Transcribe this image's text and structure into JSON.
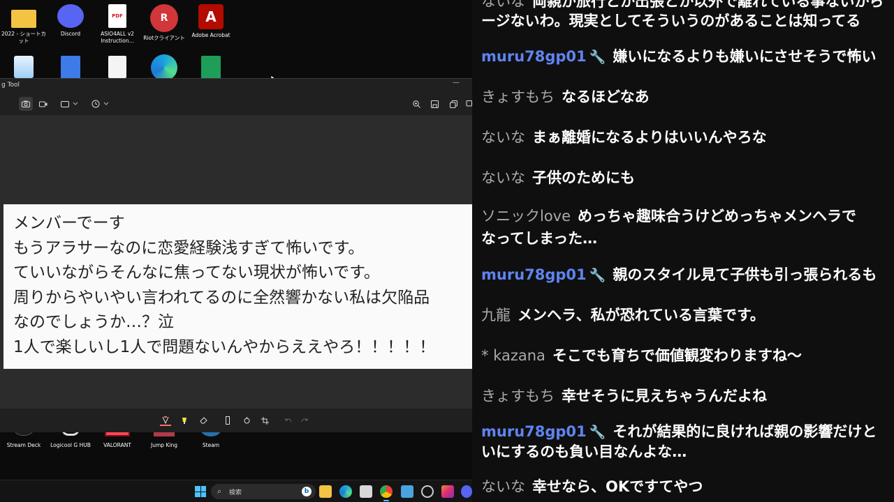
{
  "desktop": {
    "top_icons": [
      {
        "label": "2022 - ショートカット",
        "icon": "folder-icon"
      },
      {
        "label": "Discord",
        "icon": "discord-icon"
      },
      {
        "label": "ASIO4ALL v2 Instruction...",
        "icon": "pdf-icon",
        "badge": "PDF"
      },
      {
        "label": "Riotクライアント",
        "icon": "riot-icon",
        "badge": "R"
      },
      {
        "label": "Adobe Acrobat",
        "icon": "acrobat-icon",
        "badge": "A"
      }
    ],
    "second_row_icons": [
      {
        "icon": "recycle-bin-icon"
      },
      {
        "icon": "google-docs-icon"
      },
      {
        "icon": "file-icon"
      },
      {
        "icon": "edge-icon"
      },
      {
        "icon": "google-sheets-icon"
      }
    ],
    "bottom_icons": [
      {
        "label": "Stream Deck",
        "icon": "stream-deck-icon"
      },
      {
        "label": "Logicool G HUB",
        "icon": "ghub-icon"
      },
      {
        "label": "VALORANT",
        "icon": "valorant-icon"
      },
      {
        "label": "Jump King",
        "icon": "jump-king-icon"
      },
      {
        "label": "Steam",
        "icon": "steam-icon"
      }
    ]
  },
  "snipping_tool": {
    "title": "g Tool",
    "minimize": "—",
    "snip_text_lines": [
      "メンバーでーす",
      "もうアラサーなのに恋愛経験浅すぎて怖いです。",
      "ていいながらそんなに焦ってない現状が怖いです。",
      "周りからやいやい言われてるのに全然響かない私は欠陥品",
      "なのでしょうか…？泣",
      "1人で楽しいし1人で問題ないんやからええやろ！！！！！"
    ]
  },
  "taskbar": {
    "search_placeholder": "検索",
    "bing_label": "b"
  },
  "chat": {
    "messages": [
      {
        "author": "ないな",
        "text": "両親が旅行とか出張とか以外で離れている事ないから",
        "mod": false
      },
      {
        "author": "",
        "text": "ージないわ。現実としてそういうのがあることは知ってる",
        "mod": false
      },
      {
        "author": "muru78gp01",
        "text": "嫌いになるよりも嫌いにさせそうで怖い",
        "mod": true
      },
      {
        "author": "きょすもち",
        "text": "なるほどなあ",
        "mod": false
      },
      {
        "author": "ないな",
        "text": "まぁ離婚になるよりはいいんやろな",
        "mod": false
      },
      {
        "author": "ないな",
        "text": "子供のためにも",
        "mod": false
      },
      {
        "author": "ソニックlove",
        "text": "めっちゃ趣味合うけどめっちゃメンヘラで",
        "mod": false
      },
      {
        "author": "",
        "text": "なってしまった…",
        "mod": false
      },
      {
        "author": "muru78gp01",
        "text": "親のスタイル見て子供も引っ張られるも",
        "mod": true
      },
      {
        "author": "九龍",
        "text": "メンヘラ、私が恐れている言葉です。",
        "mod": false
      },
      {
        "author": "* kazana",
        "text": "そこでも育ちで価値観変わりますね〜",
        "mod": false
      },
      {
        "author": "きょすもち",
        "text": "幸せそうに見えちゃうんだよね",
        "mod": false
      },
      {
        "author": "muru78gp01",
        "text": "それが結果的に良ければ親の影響だけと",
        "mod": true
      },
      {
        "author": "",
        "text": "いにするのも負い目なんよな…",
        "mod": false
      },
      {
        "author": "ないな",
        "text": "幸せなら、OKですてやつ",
        "mod": false
      }
    ],
    "wrench_glyph": "🔧"
  },
  "colors": {
    "mod_name": "#5e84f1",
    "chat_bg": "#0f0f0f",
    "snip_bg": "#202020"
  }
}
